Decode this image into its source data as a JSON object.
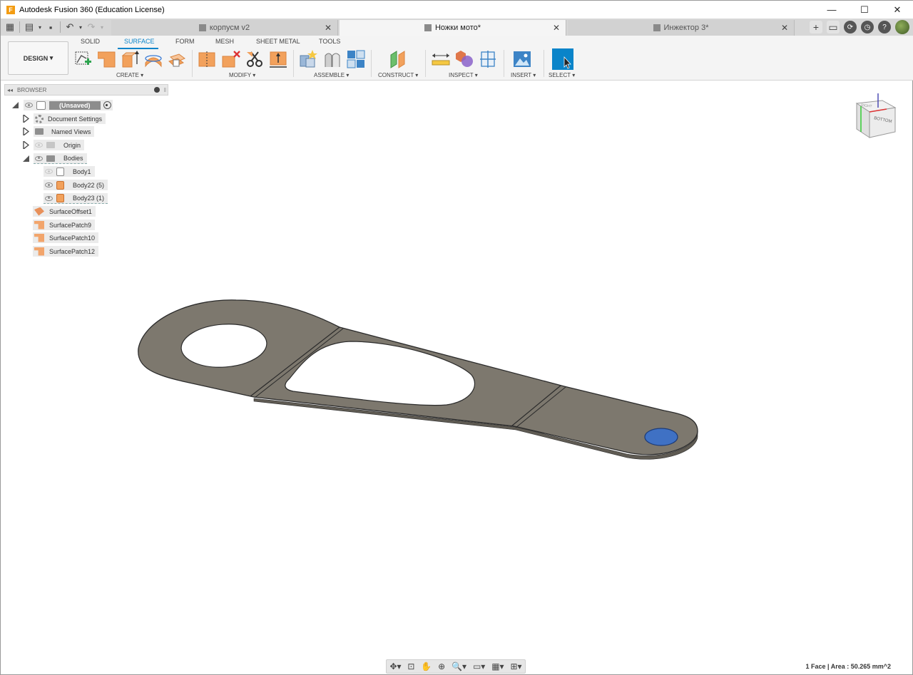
{
  "window": {
    "title": "Autodesk Fusion 360 (Education License)",
    "controls": {
      "minimize": "—",
      "maximize": "☐",
      "close": "✕"
    }
  },
  "tabs": [
    {
      "label": "корпусм v2"
    },
    {
      "label": "Ножки мото*",
      "active": true
    },
    {
      "label": "Инжектор 3*"
    }
  ],
  "ribbon": {
    "workspace": "DESIGN",
    "tabs": [
      "SOLID",
      "SURFACE",
      "FORM",
      "MESH",
      "SHEET METAL",
      "TOOLS"
    ],
    "active_tab": "SURFACE",
    "groups": [
      "CREATE",
      "MODIFY",
      "ASSEMBLE",
      "CONSTRUCT",
      "INSPECT",
      "INSERT",
      "SELECT"
    ]
  },
  "browser": {
    "title": "BROWSER",
    "root": "(Unsaved)",
    "items": [
      {
        "label": "Document Settings"
      },
      {
        "label": "Named Views"
      },
      {
        "label": "Origin"
      },
      {
        "label": "Bodies"
      },
      {
        "label": "Body1"
      },
      {
        "label": "Body22 (5)"
      },
      {
        "label": "Body23 (1)"
      },
      {
        "label": "SurfaceOffset1"
      },
      {
        "label": "SurfacePatch9"
      },
      {
        "label": "SurfacePatch10"
      },
      {
        "label": "SurfacePatch12"
      }
    ]
  },
  "viewcube": {
    "face": "BOTTOM",
    "side": "RIGHT"
  },
  "status": "1 Face | Area : 50.265 mm^2",
  "colors": {
    "accent": "#0a84c9",
    "part": "#7d786e",
    "part_edge": "#2b2b2b",
    "selected_face": "#3f71c4"
  }
}
